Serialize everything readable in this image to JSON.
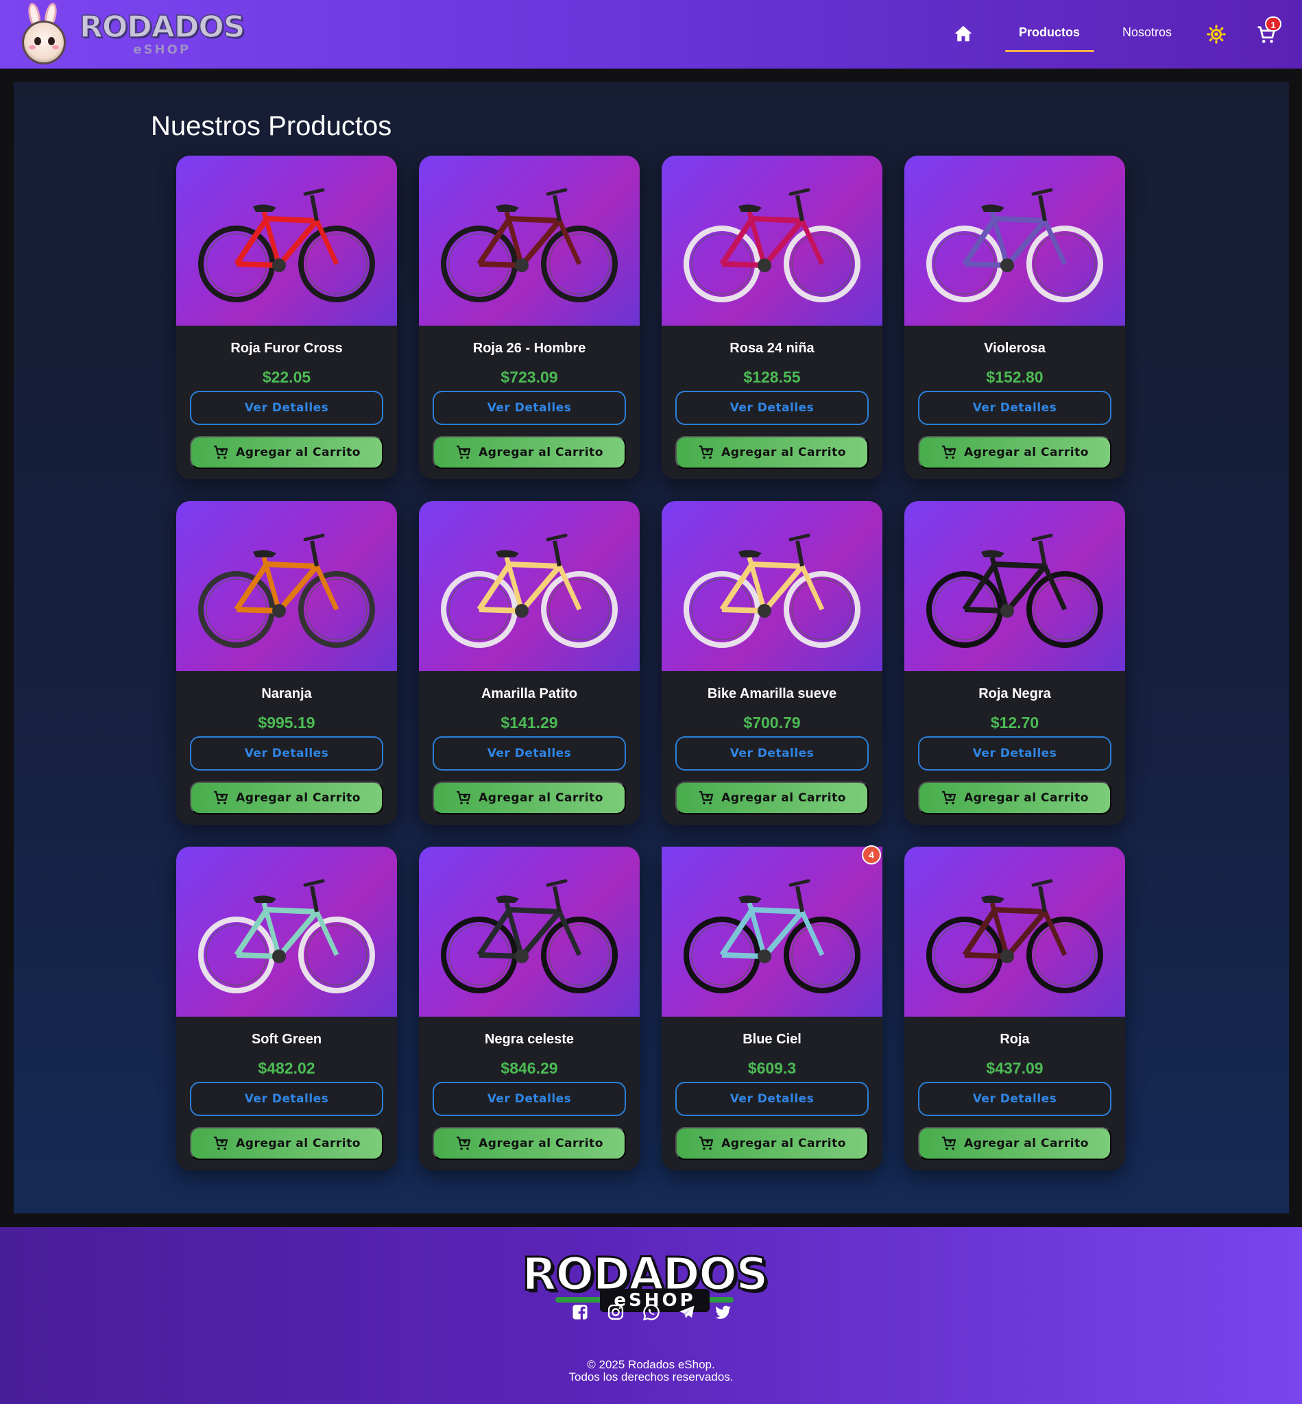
{
  "brand": {
    "logo_main": "RODADOS",
    "logo_sub": "eSHOP"
  },
  "nav": {
    "home_icon": "home-icon",
    "productos": "Productos",
    "nosotros": "Nosotros",
    "theme_icon": "sun-icon",
    "cart_icon": "cart-icon",
    "cart_count": "1"
  },
  "page": {
    "title": "Nuestros Productos"
  },
  "buttons": {
    "details": "Ver Detalles",
    "add_to_cart": "Agregar al Carrito"
  },
  "products": [
    {
      "name": "Roja Furor Cross",
      "price": "$22.05"
    },
    {
      "name": "Roja 26 - Hombre",
      "price": "$723.09"
    },
    {
      "name": "Rosa 24 niña",
      "price": "$128.55"
    },
    {
      "name": "Violerosa",
      "price": "$152.80"
    },
    {
      "name": "Naranja",
      "price": "$995.19"
    },
    {
      "name": "Amarilla Patito",
      "price": "$141.29"
    },
    {
      "name": "Bike Amarilla sueve",
      "price": "$700.79"
    },
    {
      "name": "Roja Negra",
      "price": "$12.70"
    },
    {
      "name": "Soft Green",
      "price": "$482.02"
    },
    {
      "name": "Negra celeste",
      "price": "$846.29"
    },
    {
      "name": "Blue Ciel",
      "price": "$609.3",
      "badge": "4"
    },
    {
      "name": "Roja",
      "price": "$437.09"
    }
  ],
  "footer": {
    "logo_main": "RODADOS",
    "logo_sub": "eSHOP",
    "social_icons": [
      "facebook-icon",
      "instagram-icon",
      "whatsapp-icon",
      "telegram-icon",
      "twitter-icon"
    ],
    "copyright": "© 2025 Rodados eShop.",
    "rights": "Todos los derechos reservados."
  },
  "colors": {
    "nav_gradient_start": "#7d45f0",
    "accent_underline": "#ffb24a",
    "price": "#4cbb55",
    "details_border": "#2b7fd9",
    "cart_button": "#48ad4d",
    "badge": "#e3262c"
  }
}
